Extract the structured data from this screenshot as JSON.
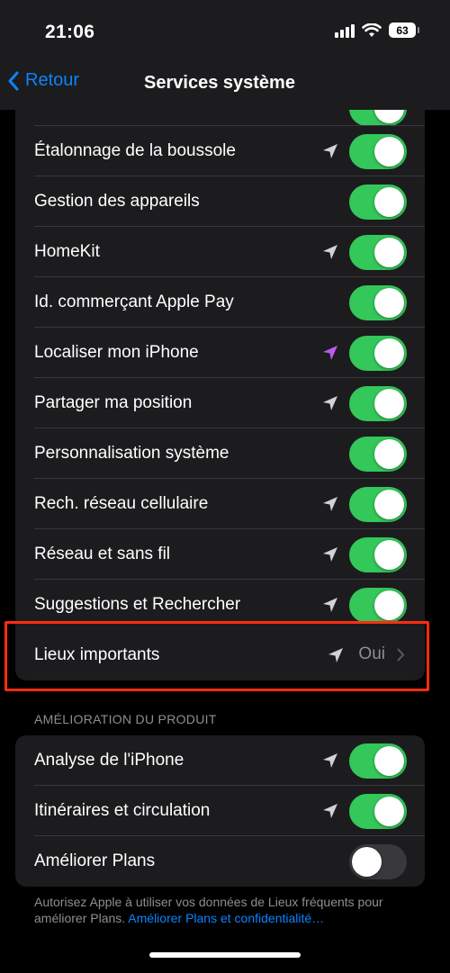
{
  "status_bar": {
    "time": "21:06",
    "battery": "63"
  },
  "nav": {
    "back_label": "Retour",
    "title": "Services système"
  },
  "system_services": [
    {
      "label": "Étalonnage de la boussole",
      "location_icon": "location-arrow-gray",
      "toggle": "on"
    },
    {
      "label": "Gestion des appareils",
      "location_icon": "",
      "toggle": "on"
    },
    {
      "label": "HomeKit",
      "location_icon": "location-arrow-gray",
      "toggle": "on"
    },
    {
      "label": "Id. commerçant Apple Pay",
      "location_icon": "",
      "toggle": "on"
    },
    {
      "label": "Localiser mon iPhone",
      "location_icon": "location-arrow-purple",
      "toggle": "on"
    },
    {
      "label": "Partager ma position",
      "location_icon": "location-arrow-gray",
      "toggle": "on"
    },
    {
      "label": "Personnalisation système",
      "location_icon": "",
      "toggle": "on"
    },
    {
      "label": "Rech. réseau cellulaire",
      "location_icon": "location-arrow-gray",
      "toggle": "on"
    },
    {
      "label": "Réseau et sans fil",
      "location_icon": "location-arrow-gray",
      "toggle": "on"
    },
    {
      "label": "Suggestions et Rechercher",
      "location_icon": "location-arrow-gray",
      "toggle": "on"
    }
  ],
  "important_locations": {
    "label": "Lieux importants",
    "value": "Oui",
    "location_icon": "location-arrow-gray"
  },
  "product_section": {
    "header": "AMÉLIORATION DU PRODUIT",
    "items": [
      {
        "label": "Analyse de l'iPhone",
        "location_icon": "location-arrow-gray",
        "toggle": "on"
      },
      {
        "label": "Itinéraires et circulation",
        "location_icon": "location-arrow-gray",
        "toggle": "on"
      },
      {
        "label": "Améliorer Plans",
        "location_icon": "",
        "toggle": "off"
      }
    ]
  },
  "footer": {
    "text": "Autorisez Apple à utiliser vos données de Lieux fréquents pour améliorer Plans.",
    "link": "Améliorer Plans et confidentialité…"
  },
  "colors": {
    "accent": "#0a84ff",
    "toggle_on": "#34c759",
    "highlight": "#ff2d10",
    "purple_arrow": "#bf5af2"
  }
}
